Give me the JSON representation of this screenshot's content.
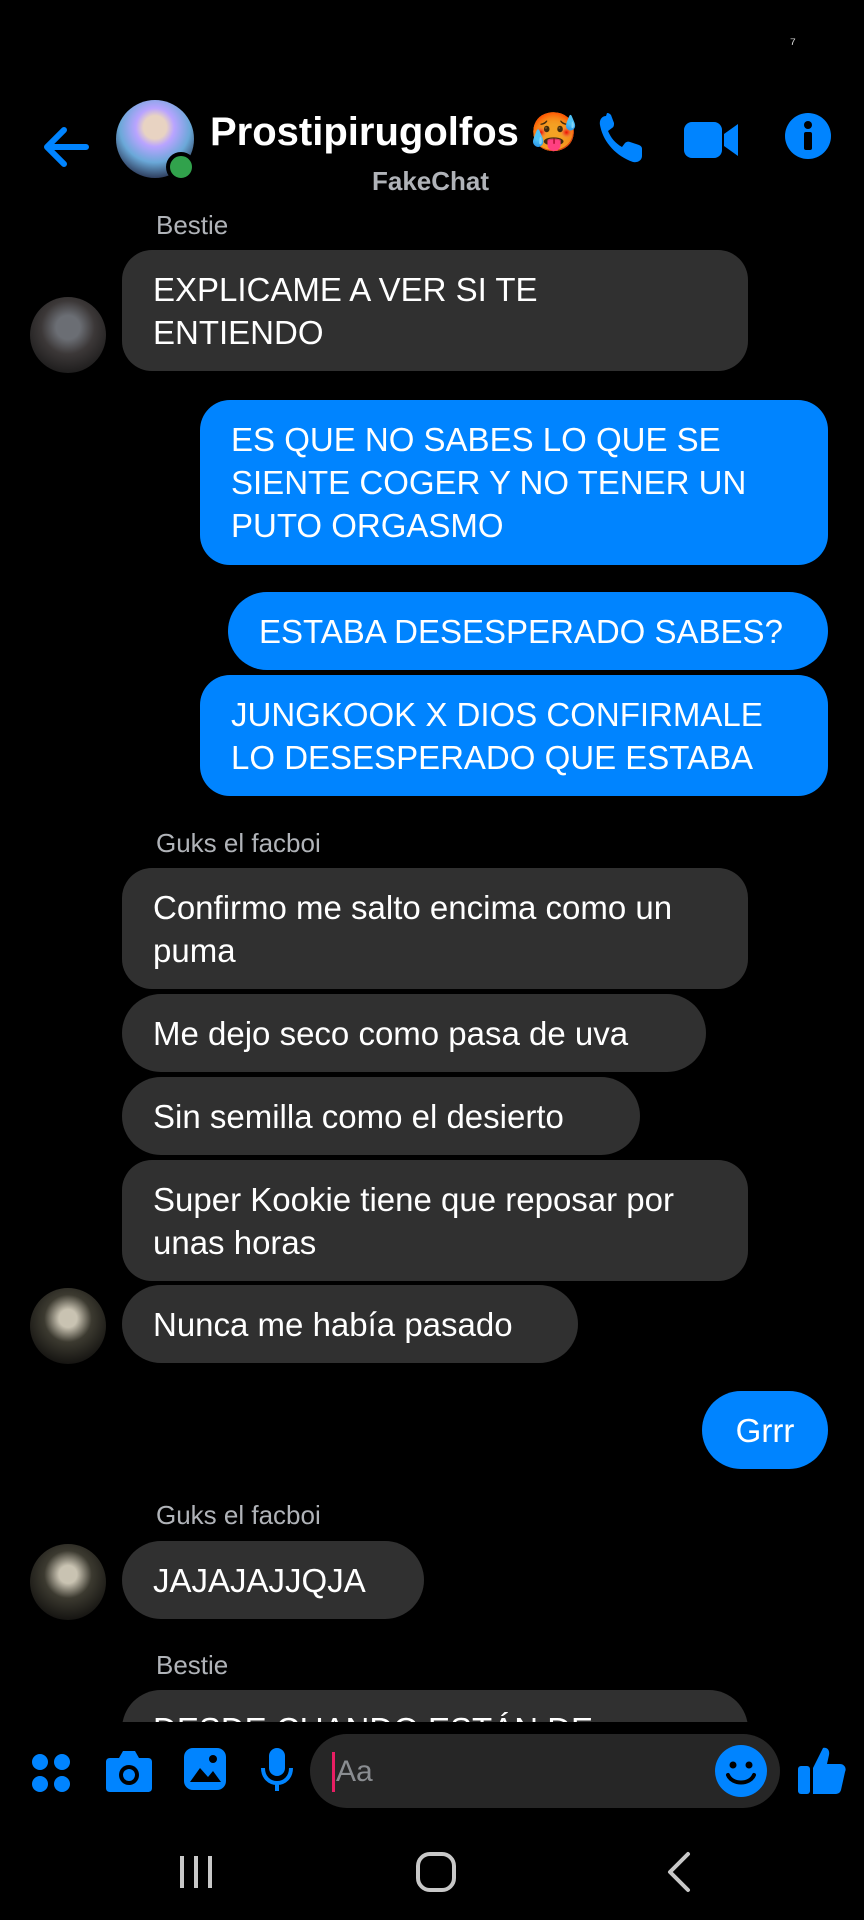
{
  "status": {
    "indicator": "⁷"
  },
  "header": {
    "title": "Prostipirugolfos",
    "title_emoji": "🥵",
    "subtitle": "FakeChat",
    "icons": [
      "back-arrow-icon",
      "phone-icon",
      "video-camera-icon",
      "info-icon"
    ],
    "accent": "#0084ff"
  },
  "messages": {
    "sender1": "Bestie",
    "m1": "EXPLICAME A VER SI TE ENTIENDO",
    "m2": "ES QUE NO SABES LO QUE SE SIENTE COGER Y NO TENER UN PUTO ORGASMO",
    "m3": "ESTABA DESESPERADO SABES?",
    "m4": "JUNGKOOK X DIOS CONFIRMALE LO DESESPERADO QUE ESTABA",
    "sender2": "Guks el facboi",
    "m5": "Confirmo me salto encima como un puma",
    "m6": "Me dejo seco como pasa de uva",
    "m7": "Sin semilla como el desierto",
    "m8": "Super Kookie tiene que reposar por unas horas",
    "m9": "Nunca me había pasado",
    "m10": "Grrr",
    "sender3": "Guks el facboi",
    "m11": "JAJAJAJJQJA",
    "sender4": "Bestie",
    "m12_partial": "DESDE CUANDO ESTÁN DE"
  },
  "composer": {
    "placeholder": "Aa",
    "icons": [
      "apps-dots-icon",
      "camera-icon",
      "image-icon",
      "microphone-icon",
      "emoji-icon",
      "thumbs-up-icon"
    ]
  },
  "nav": {
    "icons": [
      "recent-apps-icon",
      "home-icon",
      "back-icon"
    ]
  }
}
